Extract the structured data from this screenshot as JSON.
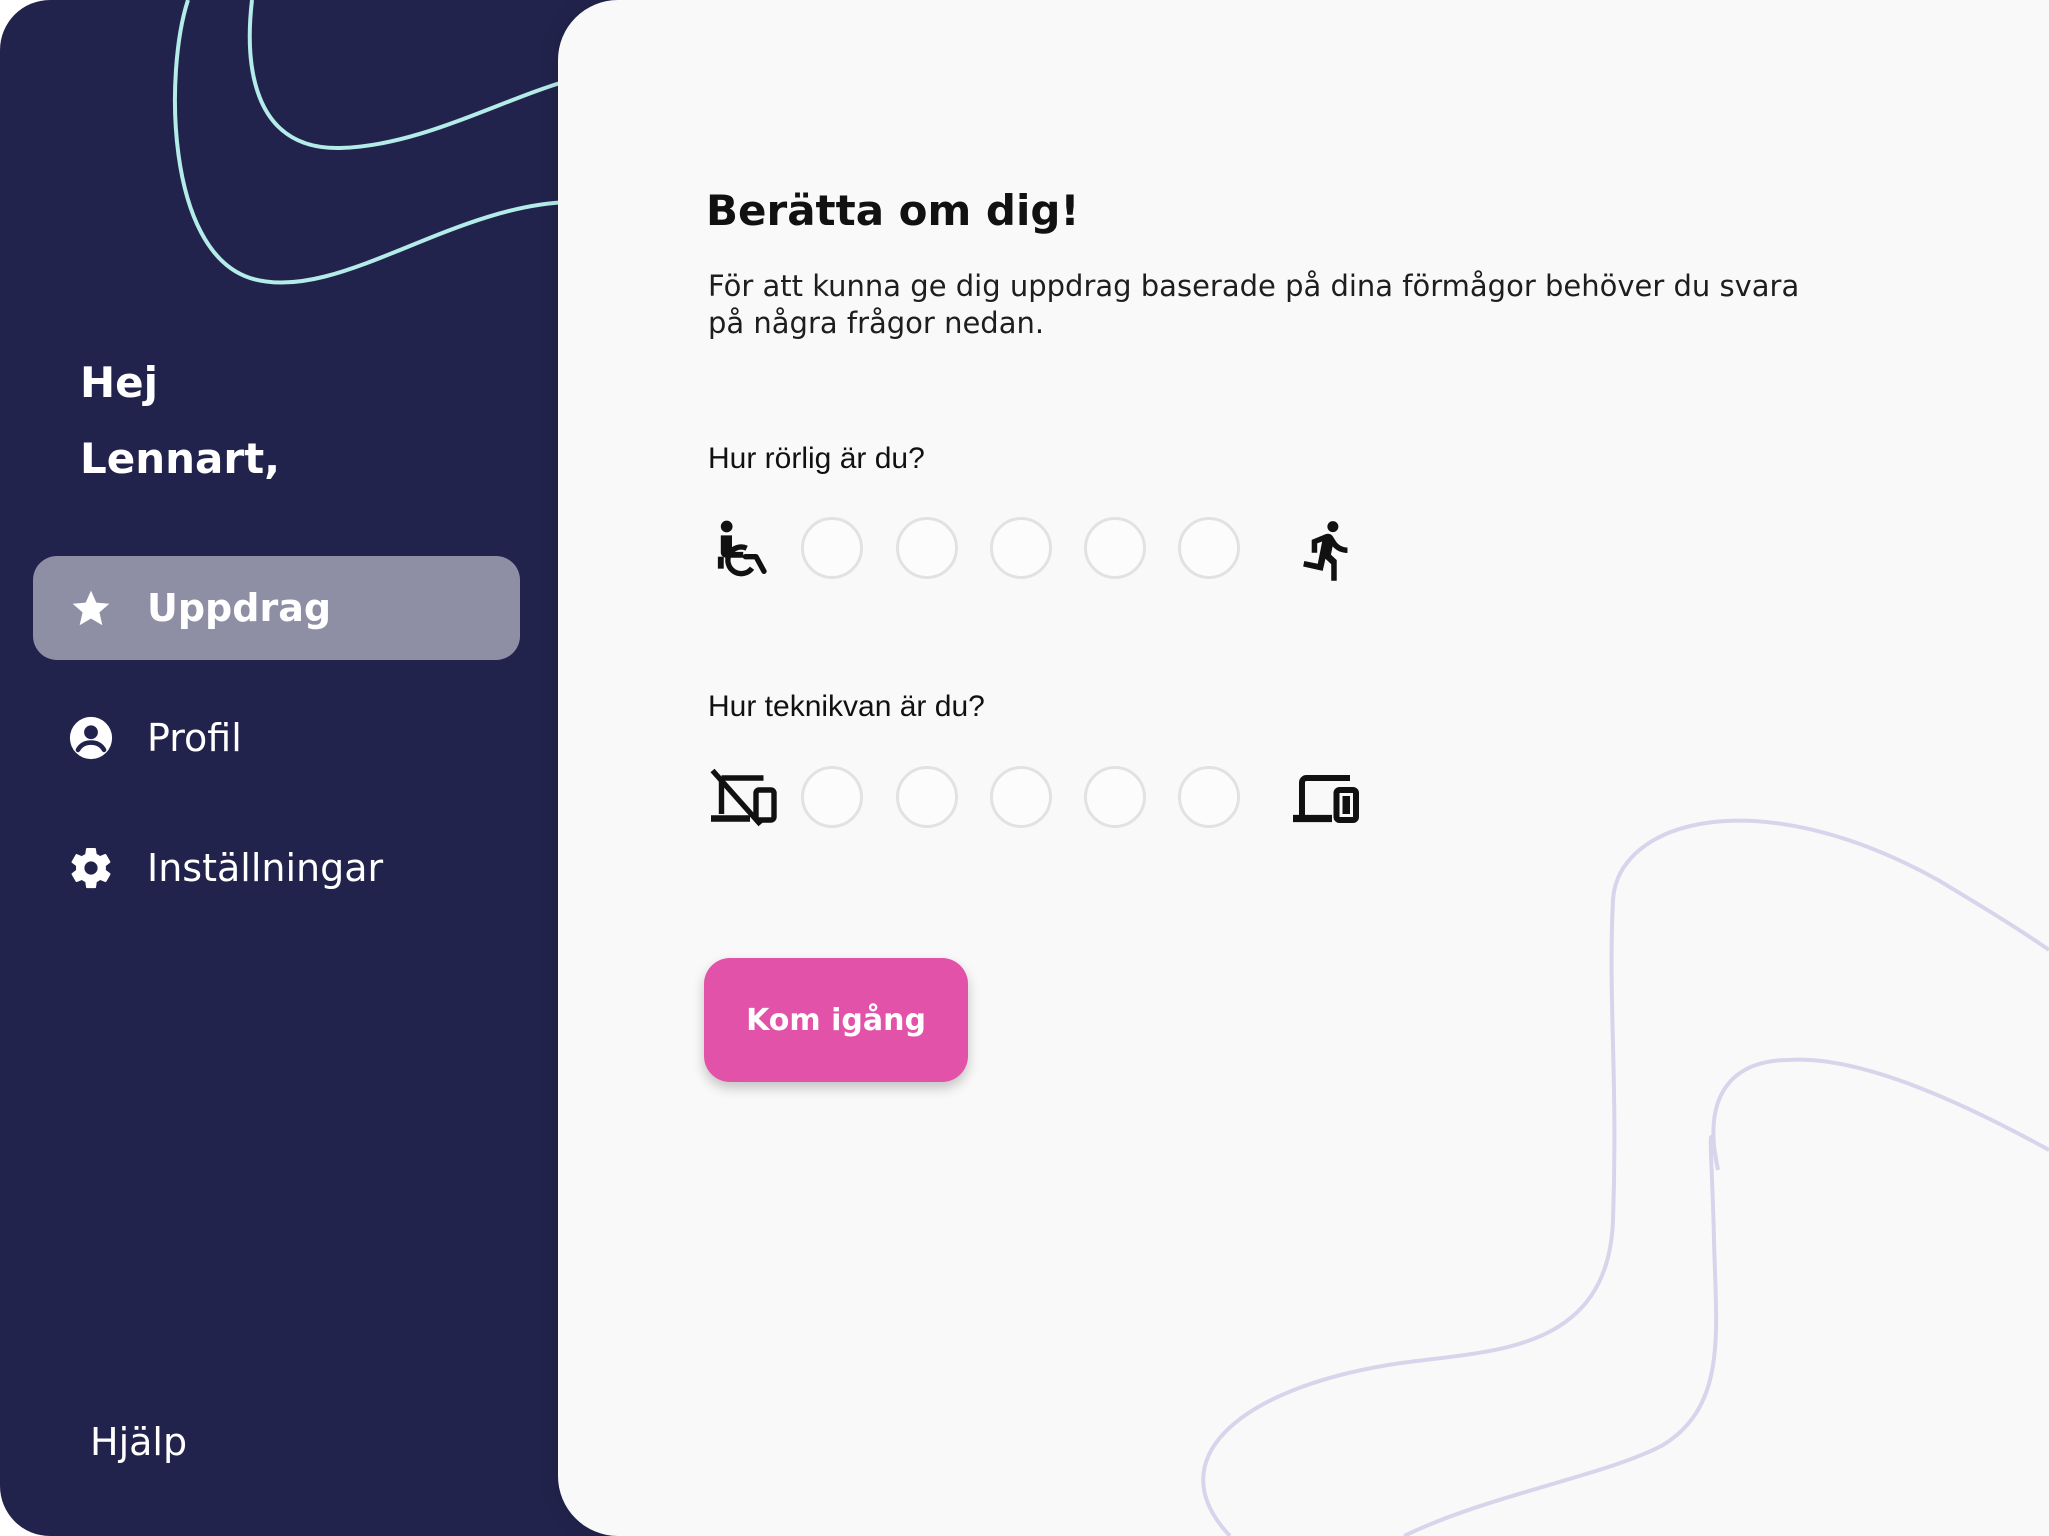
{
  "sidebar": {
    "greeting_line1": "Hej",
    "greeting_line2": "Lennart,",
    "items": [
      {
        "label": "Uppdrag",
        "icon": "star-icon",
        "active": true
      },
      {
        "label": "Profil",
        "icon": "account-circle-icon",
        "active": false
      },
      {
        "label": "Inställningar",
        "icon": "gear-icon",
        "active": false
      }
    ],
    "help_label": "Hjälp",
    "background_color": "#22234c",
    "active_item_color": "#8e8fa5",
    "curve_color": "#b3ece9"
  },
  "main": {
    "title": "Berätta om dig!",
    "description": "För att kunna ge dig uppdrag baserade på dina förmågor behöver du svara på några frågor nedan.",
    "questions": [
      {
        "label": "Hur rörlig är du?",
        "low_icon": "wheelchair-icon",
        "high_icon": "running-person-icon",
        "options": 5
      },
      {
        "label": "Hur teknikvan är du?",
        "low_icon": "devices-off-icon",
        "high_icon": "devices-icon",
        "options": 5
      }
    ],
    "cta_label": "Kom igång",
    "cta_color": "#e352a9",
    "curve_color": "#d9d4ec",
    "background_color": "#f9f9f9"
  }
}
